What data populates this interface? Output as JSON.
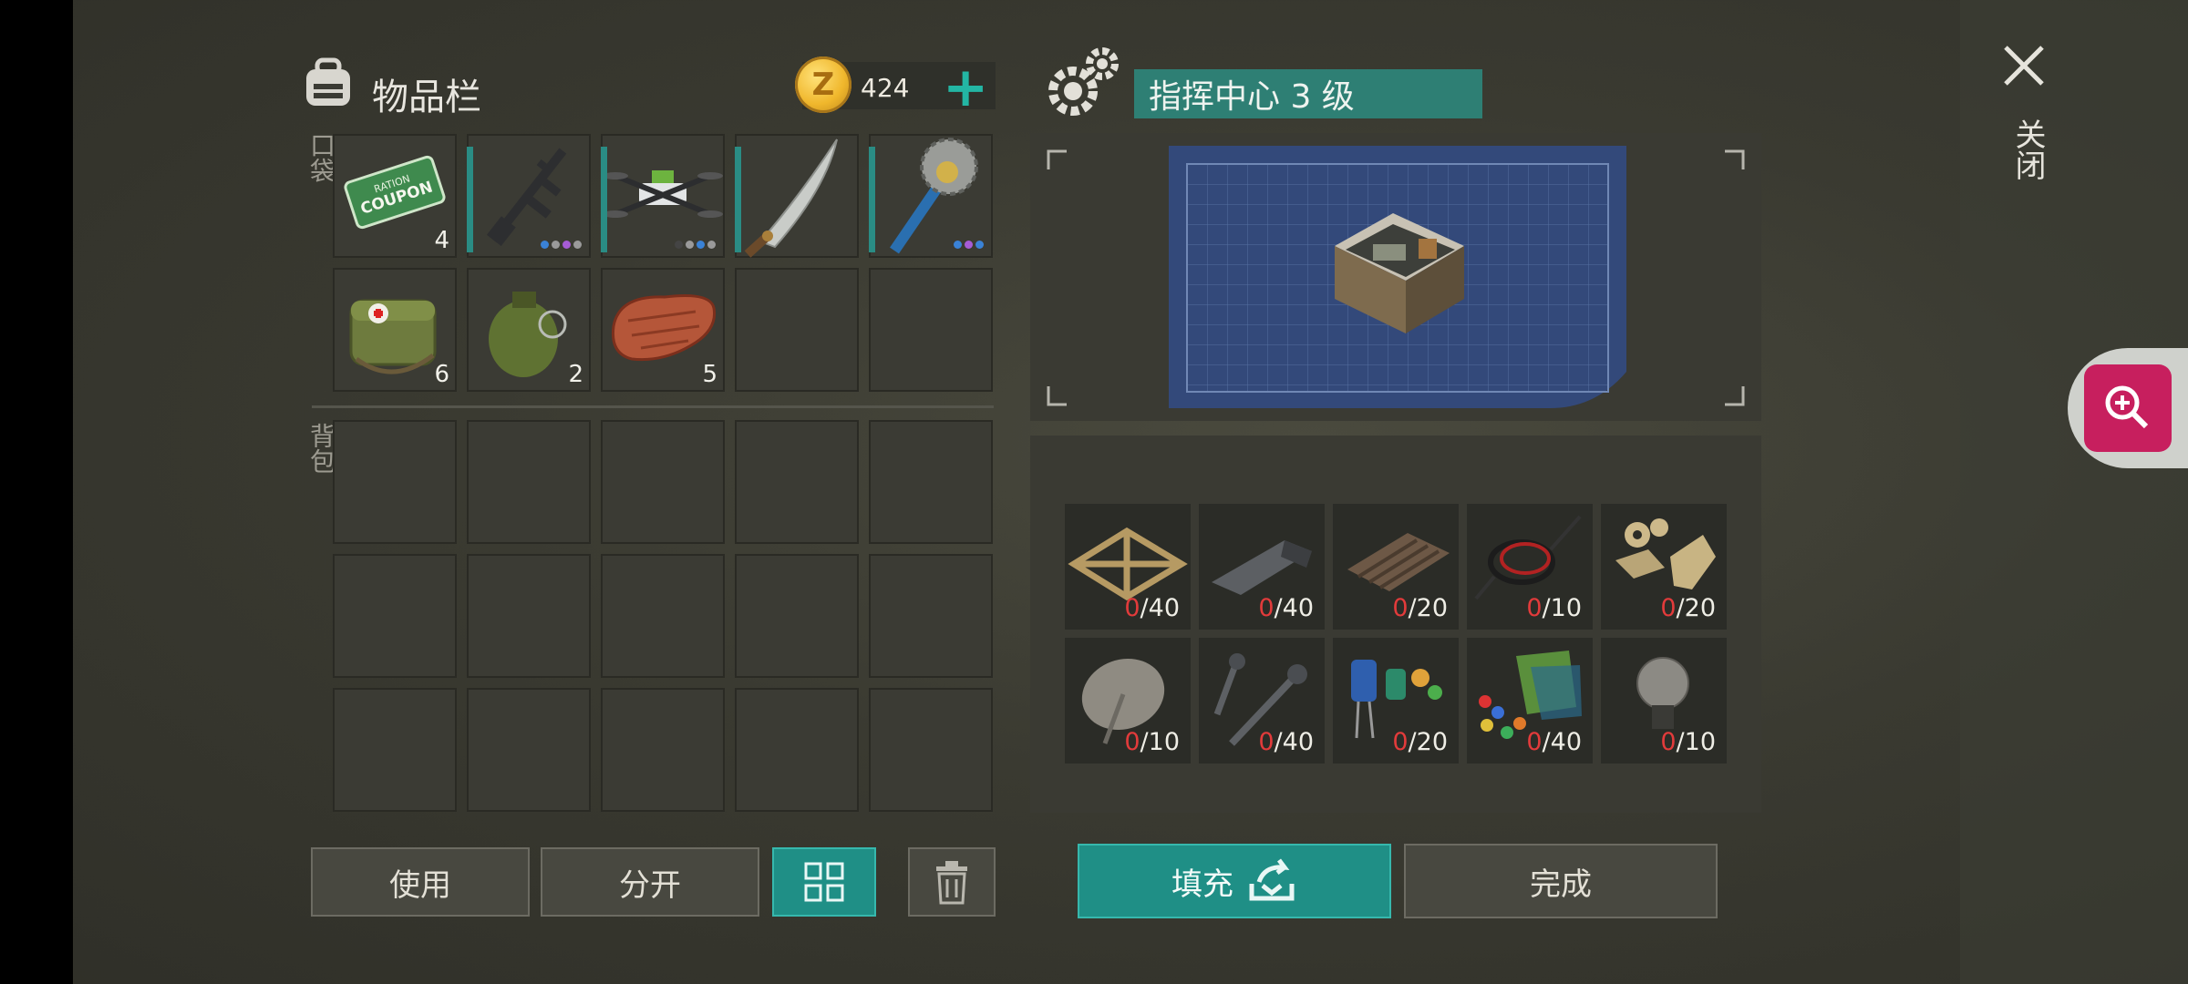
{
  "inventory": {
    "title": "物品栏",
    "coins": "424",
    "pocket_label": "口袋",
    "backpack_label": "背包",
    "pocket_items": [
      {
        "name": "ration-coupon",
        "qty": "4"
      },
      {
        "name": "assault-rifle",
        "qty": ""
      },
      {
        "name": "drone",
        "qty": ""
      },
      {
        "name": "machete",
        "qty": ""
      },
      {
        "name": "saw-club",
        "qty": ""
      },
      {
        "name": "medkit-bag",
        "qty": "6"
      },
      {
        "name": "grenade",
        "qty": "2"
      },
      {
        "name": "raw-meat",
        "qty": "5"
      },
      {
        "name": "empty",
        "qty": ""
      },
      {
        "name": "empty",
        "qty": ""
      }
    ]
  },
  "building": {
    "title": "指挥中心 3 级",
    "materials": [
      {
        "name": "wood-frame",
        "have": "0",
        "need": "/40"
      },
      {
        "name": "metal-bar",
        "have": "0",
        "need": "/40"
      },
      {
        "name": "corrugated-sheet",
        "have": "0",
        "need": "/20"
      },
      {
        "name": "wires",
        "have": "0",
        "need": "/10"
      },
      {
        "name": "gears",
        "have": "0",
        "need": "/20"
      },
      {
        "name": "satellite-dish",
        "have": "0",
        "need": "/10"
      },
      {
        "name": "screws",
        "have": "0",
        "need": "/40"
      },
      {
        "name": "capacitors",
        "have": "0",
        "need": "/20"
      },
      {
        "name": "circuit-parts",
        "have": "0",
        "need": "/40"
      },
      {
        "name": "light-bulb",
        "have": "0",
        "need": "/10"
      }
    ]
  },
  "buttons": {
    "use": "使用",
    "split": "分开",
    "fill": "填充",
    "done": "完成"
  },
  "close_label": "关闭",
  "colors": {
    "accent": "#1f8f86",
    "zero": "#e23b3b",
    "zoom": "#c71f5e"
  }
}
